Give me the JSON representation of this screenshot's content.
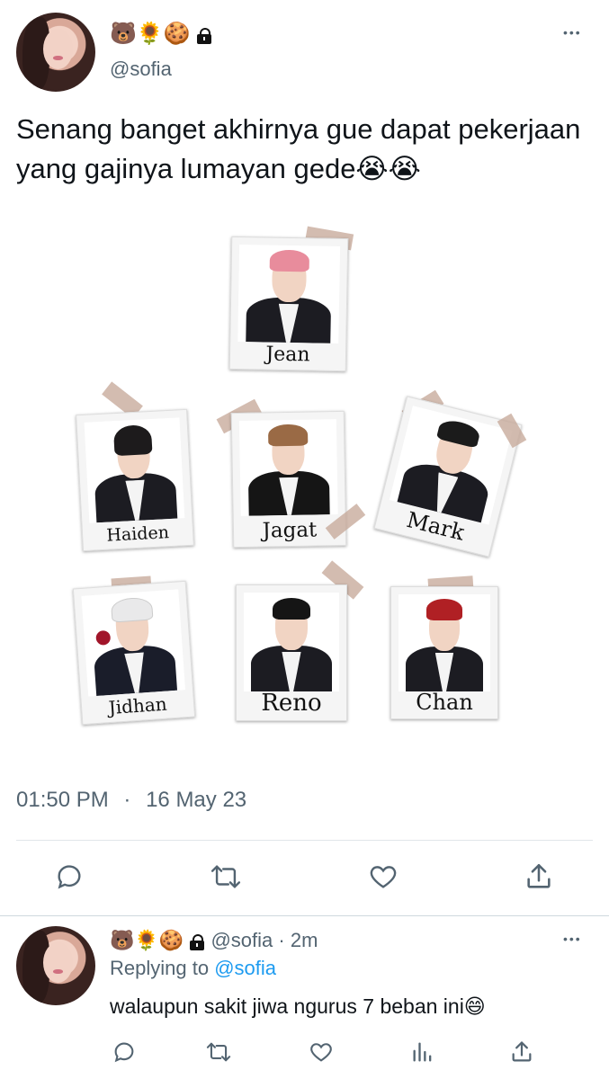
{
  "tweet": {
    "author": {
      "handle": "@sofia",
      "display_emojis": [
        "🐻",
        "🌻",
        "🍪"
      ],
      "protected": true
    },
    "text": "Senang banget akhirnya gue dapat pekerjaan yang gajinya lumayan gede😭😭",
    "time": "01:50 PM",
    "separator": "·",
    "date": "16 May 23",
    "more_label": "•••"
  },
  "polaroids": [
    {
      "name": "Jean",
      "hair_color": "#e88c9c"
    },
    {
      "name": "Haiden",
      "hair_color": "#1d1b1c"
    },
    {
      "name": "Jagat",
      "hair_color": "#9a6a45"
    },
    {
      "name": "Mark",
      "hair_color": "#1b1b1b"
    },
    {
      "name": "Jidhan",
      "hair_color": "#e9e9ea"
    },
    {
      "name": "Reno",
      "hair_color": "#151515"
    },
    {
      "name": "Chan",
      "hair_color": "#b02024"
    }
  ],
  "actions": {
    "icons": [
      "reply-icon",
      "retweet-icon",
      "like-icon",
      "share-icon"
    ]
  },
  "reply": {
    "handle": "@sofia",
    "time_ago": "2m",
    "separator": "·",
    "replying_label": "Replying to",
    "replying_to": "@sofia",
    "text": "walaupun sakit jiwa ngurus 7 beban ini😄",
    "more_label": "•••",
    "icons": [
      "reply-icon",
      "retweet-icon",
      "like-icon",
      "views-icon",
      "share-icon"
    ]
  },
  "colors": {
    "accent": "#1d9bf0",
    "secondary_text": "#536471",
    "divider": "#e1e6ea"
  }
}
